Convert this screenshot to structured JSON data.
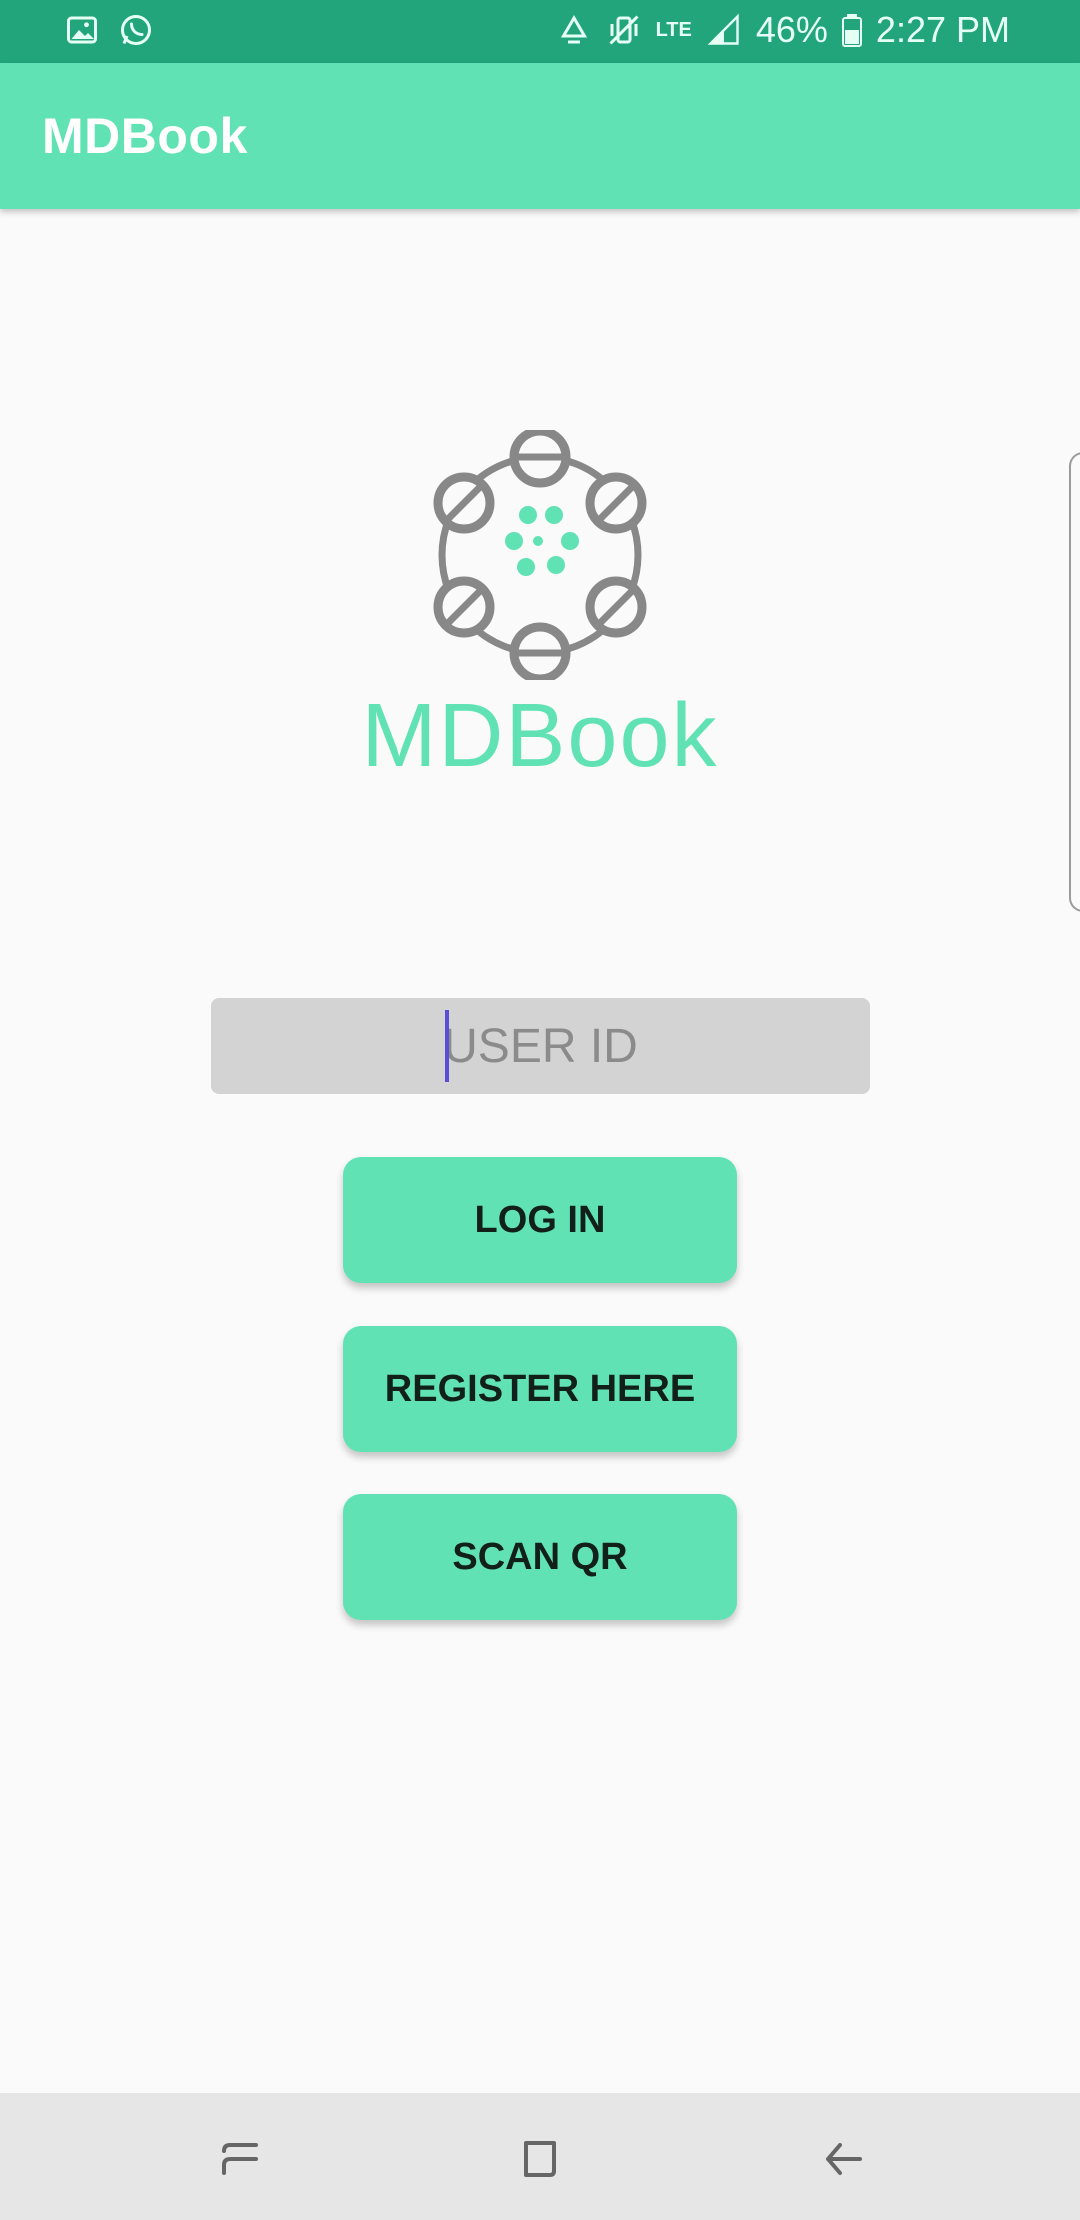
{
  "status_bar": {
    "left_icons": [
      "image-icon",
      "whatsapp-icon"
    ],
    "right_icons": [
      "recycle-icon",
      "vibrate-mute-icon",
      "lte-icon",
      "signal-icon"
    ],
    "network": "LTE",
    "battery_percent": "46%",
    "time": "2:27 PM",
    "color": "#22a57b"
  },
  "app_bar": {
    "title": "MDBook",
    "color": "#61e2b5"
  },
  "logo": {
    "text": "MDBook",
    "icon": "molecule-logo-icon"
  },
  "form": {
    "user_id_placeholder": "USER ID",
    "user_id_value": ""
  },
  "buttons": {
    "login": "LOG IN",
    "register": "REGISTER HERE",
    "scan_qr": "SCAN QR"
  },
  "nav_bar": {
    "icons": [
      "recents-icon",
      "home-icon",
      "back-icon"
    ]
  }
}
